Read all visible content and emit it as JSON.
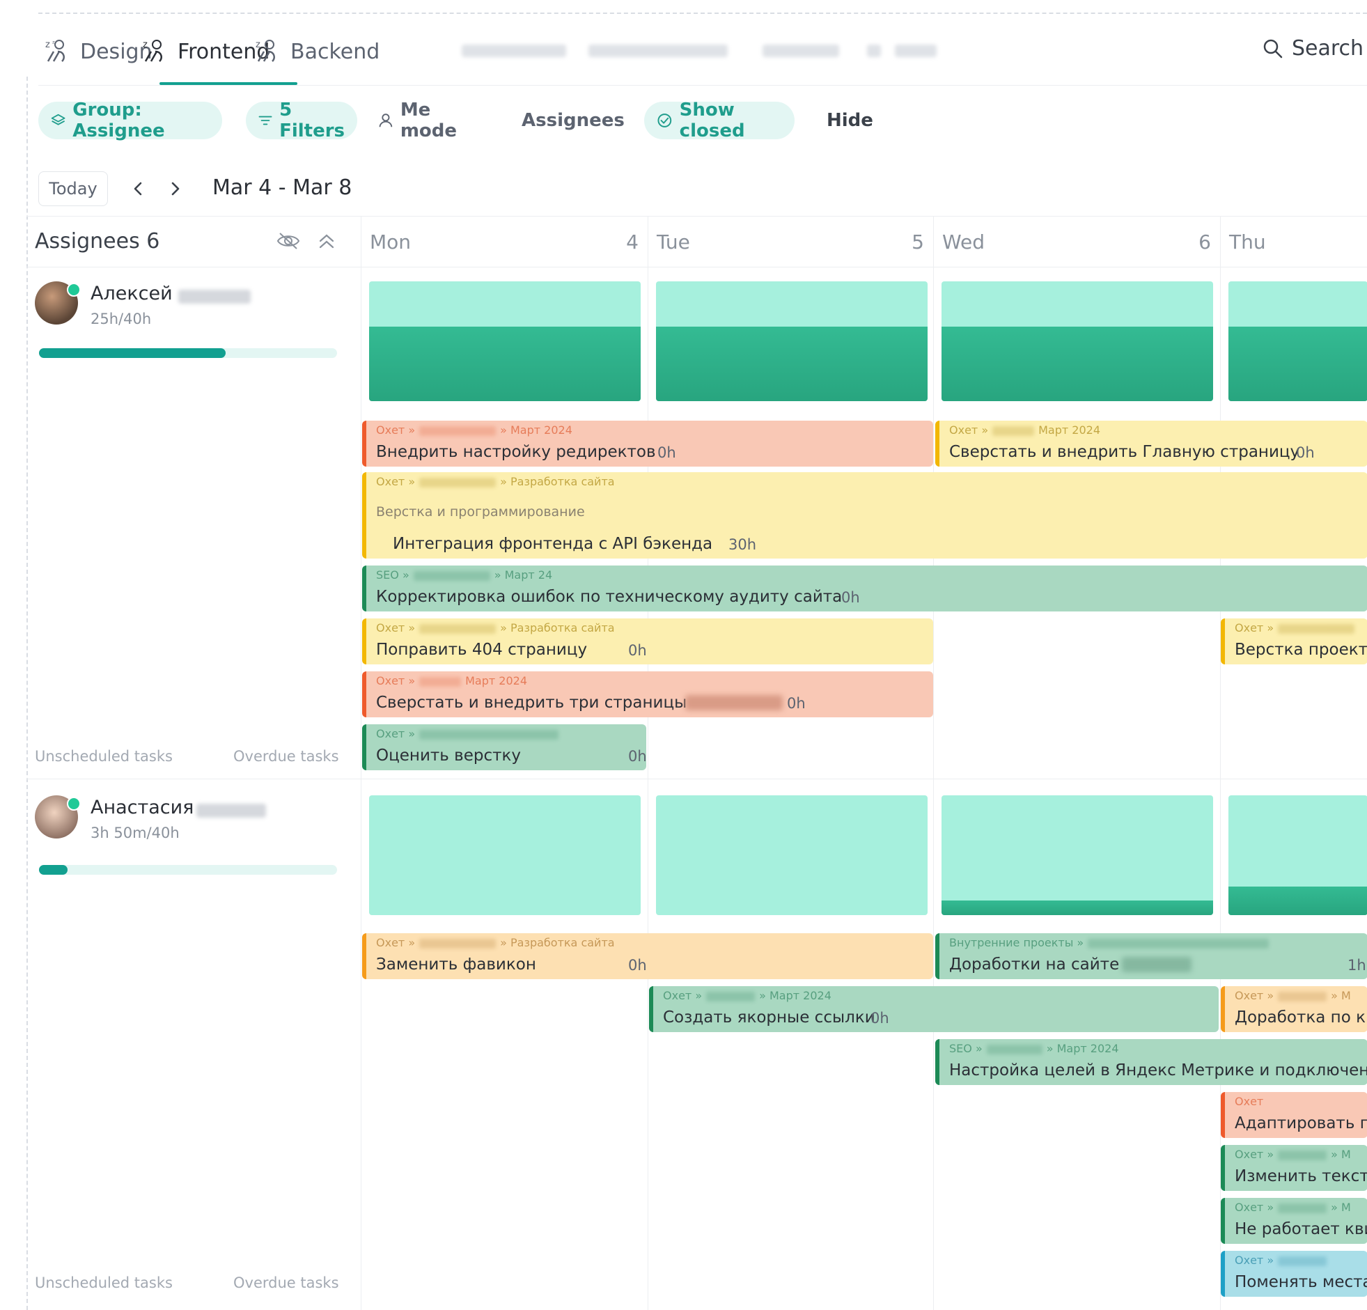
{
  "tabs": [
    {
      "label": "Design",
      "active": false
    },
    {
      "label": "Frontend",
      "active": true
    },
    {
      "label": "Backend",
      "active": false
    }
  ],
  "search_label": "Search",
  "toolbar": {
    "group": "Group: Assignee",
    "filters": "5 Filters",
    "me_mode": "Me mode",
    "assignees": "Assignees",
    "show_closed": "Show closed",
    "hide": "Hide"
  },
  "datenav": {
    "today": "Today",
    "range": "Mar 4 - Mar 8"
  },
  "grid": {
    "assignees_title": "Assignees 6",
    "days": [
      {
        "name": "Mon",
        "num": "4"
      },
      {
        "name": "Tue",
        "num": "5"
      },
      {
        "name": "Wed",
        "num": "6"
      },
      {
        "name": "Thu",
        "num": ""
      }
    ]
  },
  "assignees": [
    {
      "name": "Алексей",
      "hours": "25h/40h",
      "progress": 0.625,
      "unscheduled": "Unscheduled tasks",
      "overdue": "Overdue tasks",
      "workload": [
        0.62,
        0.62,
        0.62,
        0.62
      ]
    },
    {
      "name": "Анастасия",
      "hours": "3h 50m/40h",
      "progress": 0.096,
      "unscheduled": "Unscheduled tasks",
      "overdue": "Overdue tasks",
      "workload": [
        0,
        0,
        0.12,
        0.24
      ]
    }
  ],
  "tasks_a": [
    {
      "crumb_a": "Охет »",
      "crumb_b": "» Март 2024",
      "name": "Внедрить настройку редиректов",
      "hours": "0h"
    },
    {
      "crumb_a": "Охет »",
      "crumb_b": "Март 2024",
      "name": "Сверстать и внедрить Главную страницу",
      "hours": "0h"
    },
    {
      "crumb_a": "Охет »",
      "crumb_b": "» Разработка сайта",
      "sub": "Верстка и программирование",
      "name": "Интеграция фронтенда с API бэкенда",
      "hours": "30h"
    },
    {
      "crumb_a": "SEO »",
      "crumb_b": "» Март 24",
      "name": "Корректировка ошибок по техническому аудиту сайта",
      "hours": "0h"
    },
    {
      "crumb_a": "Охет »",
      "crumb_b": "» Разработка сайта",
      "name": "Поправить 404 страницу",
      "hours": "0h"
    },
    {
      "crumb_a": "Охет »",
      "crumb_b": "",
      "name": "Верстка проекта",
      "hours": ""
    },
    {
      "crumb_a": "Охет »",
      "crumb_b": "Март 2024",
      "name": "Сверстать и внедрить три страницы",
      "hours": "0h"
    },
    {
      "crumb_a": "Охет »",
      "crumb_b": "",
      "name": "Оценить верстку",
      "hours": "0h"
    }
  ],
  "tasks_b": [
    {
      "crumb_a": "Охет »",
      "crumb_b": "» Разработка сайта",
      "name": "Заменить фавикон",
      "hours": "0h"
    },
    {
      "crumb_a": "Внутренние проекты »",
      "crumb_b": "",
      "name": "Доработки на сайте",
      "hours": "1h"
    },
    {
      "crumb_a": "Охет »",
      "crumb_b": "» Март 2024",
      "name": "Создать якорные ссылки",
      "hours": "0h"
    },
    {
      "crumb_a": "Охет »",
      "crumb_b": "» М",
      "name": "Доработка по к",
      "hours": ""
    },
    {
      "crumb_a": "SEO »",
      "crumb_b": "» Март 2024",
      "name": "Настройка целей в Яндекс Метрике и подключени",
      "hours": ""
    },
    {
      "crumb_a": "Охет",
      "crumb_b": "",
      "name": "Адаптировать г",
      "hours": ""
    },
    {
      "crumb_a": "Охет »",
      "crumb_b": "» М",
      "name": "Изменить текст",
      "hours": ""
    },
    {
      "crumb_a": "Охет »",
      "crumb_b": "» М",
      "name": "Не работает кви",
      "hours": ""
    },
    {
      "crumb_a": "Охет »",
      "crumb_b": "",
      "name": "Поменять места",
      "hours": ""
    }
  ],
  "colors": {
    "accent": "#12a090",
    "workload_light": "#a6f0dd",
    "workload_dark": "#2fb189"
  }
}
